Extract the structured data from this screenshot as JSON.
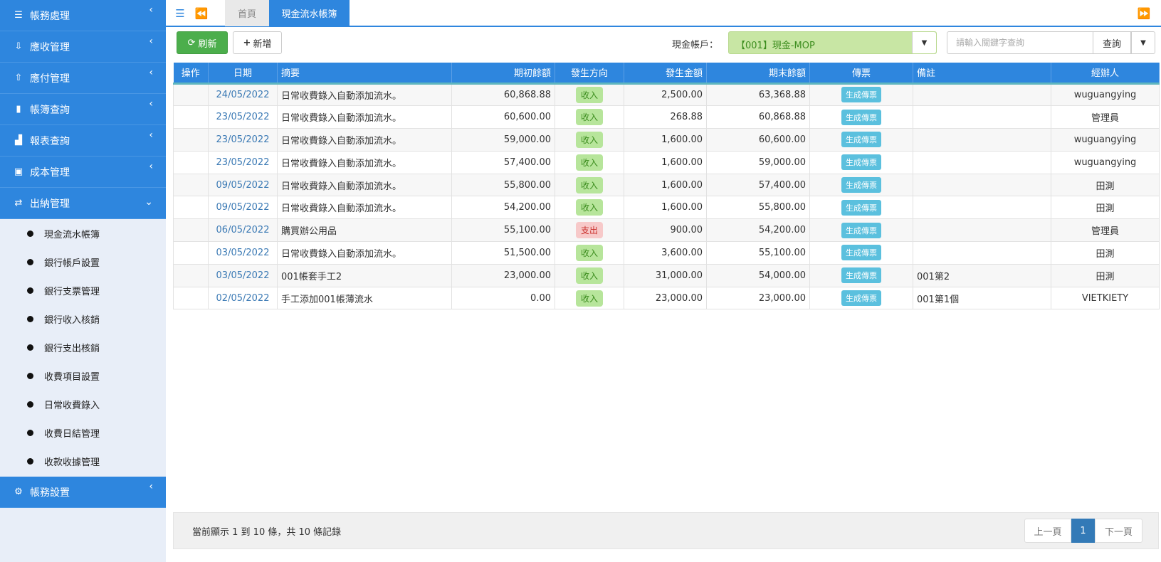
{
  "sidebar": {
    "menus": [
      {
        "label": "帳務處理",
        "icon": "list-icon"
      },
      {
        "label": "應收管理",
        "icon": "receive-icon"
      },
      {
        "label": "應付管理",
        "icon": "pay-icon"
      },
      {
        "label": "帳簿查詢",
        "icon": "book-icon"
      },
      {
        "label": "報表查詢",
        "icon": "bar-chart-icon"
      },
      {
        "label": "成本管理",
        "icon": "cost-icon"
      },
      {
        "label": "出納管理",
        "icon": "exchange-icon"
      }
    ],
    "submenu": [
      "現金流水帳簿",
      "銀行帳戶設置",
      "銀行支票管理",
      "銀行收入核銷",
      "銀行支出核銷",
      "收費項目設置",
      "日常收費錄入",
      "收費日結管理",
      "收款收據管理"
    ],
    "settings": {
      "label": "帳務設置",
      "icon": "gear-icon"
    }
  },
  "tabs": {
    "home": "首頁",
    "active": "現金流水帳簿"
  },
  "toolbar": {
    "refresh_label": "刷新",
    "add_label": "新增",
    "account_label": "現金帳戶：",
    "account_value": "【001】現金-MOP",
    "search_placeholder": "請輸入關鍵字查詢",
    "search_label": "查詢"
  },
  "table": {
    "headers": [
      "操作",
      "日期",
      "摘要",
      "期初餘額",
      "發生方向",
      "發生金額",
      "期末餘額",
      "傳票",
      "備註",
      "經辦人"
    ],
    "rows": [
      {
        "date": "24/05/2022",
        "summary": "日常收費錄入自動添加流水。",
        "opening": "60,868.88",
        "direction": "收入",
        "dir_type": "in",
        "amount": "2,500.00",
        "closing": "63,368.88",
        "voucher": "生成傳票",
        "note": "",
        "handler": "wuguangying"
      },
      {
        "date": "23/05/2022",
        "summary": "日常收費錄入自動添加流水。",
        "opening": "60,600.00",
        "direction": "收入",
        "dir_type": "in",
        "amount": "268.88",
        "closing": "60,868.88",
        "voucher": "生成傳票",
        "note": "",
        "handler": "管理員"
      },
      {
        "date": "23/05/2022",
        "summary": "日常收費錄入自動添加流水。",
        "opening": "59,000.00",
        "direction": "收入",
        "dir_type": "in",
        "amount": "1,600.00",
        "closing": "60,600.00",
        "voucher": "生成傳票",
        "note": "",
        "handler": "wuguangying"
      },
      {
        "date": "23/05/2022",
        "summary": "日常收費錄入自動添加流水。",
        "opening": "57,400.00",
        "direction": "收入",
        "dir_type": "in",
        "amount": "1,600.00",
        "closing": "59,000.00",
        "voucher": "生成傳票",
        "note": "",
        "handler": "wuguangying"
      },
      {
        "date": "09/05/2022",
        "summary": "日常收費錄入自動添加流水。",
        "opening": "55,800.00",
        "direction": "收入",
        "dir_type": "in",
        "amount": "1,600.00",
        "closing": "57,400.00",
        "voucher": "生成傳票",
        "note": "",
        "handler": "田測"
      },
      {
        "date": "09/05/2022",
        "summary": "日常收費錄入自動添加流水。",
        "opening": "54,200.00",
        "direction": "收入",
        "dir_type": "in",
        "amount": "1,600.00",
        "closing": "55,800.00",
        "voucher": "生成傳票",
        "note": "",
        "handler": "田測"
      },
      {
        "date": "06/05/2022",
        "summary": "購買辦公用品",
        "opening": "55,100.00",
        "direction": "支出",
        "dir_type": "out",
        "amount": "900.00",
        "closing": "54,200.00",
        "voucher": "生成傳票",
        "note": "",
        "handler": "管理員"
      },
      {
        "date": "03/05/2022",
        "summary": "日常收費錄入自動添加流水。",
        "opening": "51,500.00",
        "direction": "收入",
        "dir_type": "in",
        "amount": "3,600.00",
        "closing": "55,100.00",
        "voucher": "生成傳票",
        "note": "",
        "handler": "田測"
      },
      {
        "date": "03/05/2022",
        "summary": "001帳套手工2",
        "opening": "23,000.00",
        "direction": "收入",
        "dir_type": "in",
        "amount": "31,000.00",
        "closing": "54,000.00",
        "voucher": "生成傳票",
        "note": "001第2",
        "handler": "田測"
      },
      {
        "date": "02/05/2022",
        "summary": "手工添加001帳薄流水",
        "opening": "0.00",
        "direction": "收入",
        "dir_type": "in",
        "amount": "23,000.00",
        "closing": "23,000.00",
        "voucher": "生成傳票",
        "note": "001第1個",
        "handler": "VIETKIETY"
      }
    ]
  },
  "footer": {
    "info": "當前顯示 1 到 10 條，共 10 條記錄",
    "prev": "上一頁",
    "page": "1",
    "next": "下一頁"
  },
  "colors": {
    "primary": "#2e86de",
    "success": "#4cae4c",
    "income_badge": "#b7e59b",
    "expense_badge": "#f7c9c9",
    "voucher": "#5bc0de"
  }
}
